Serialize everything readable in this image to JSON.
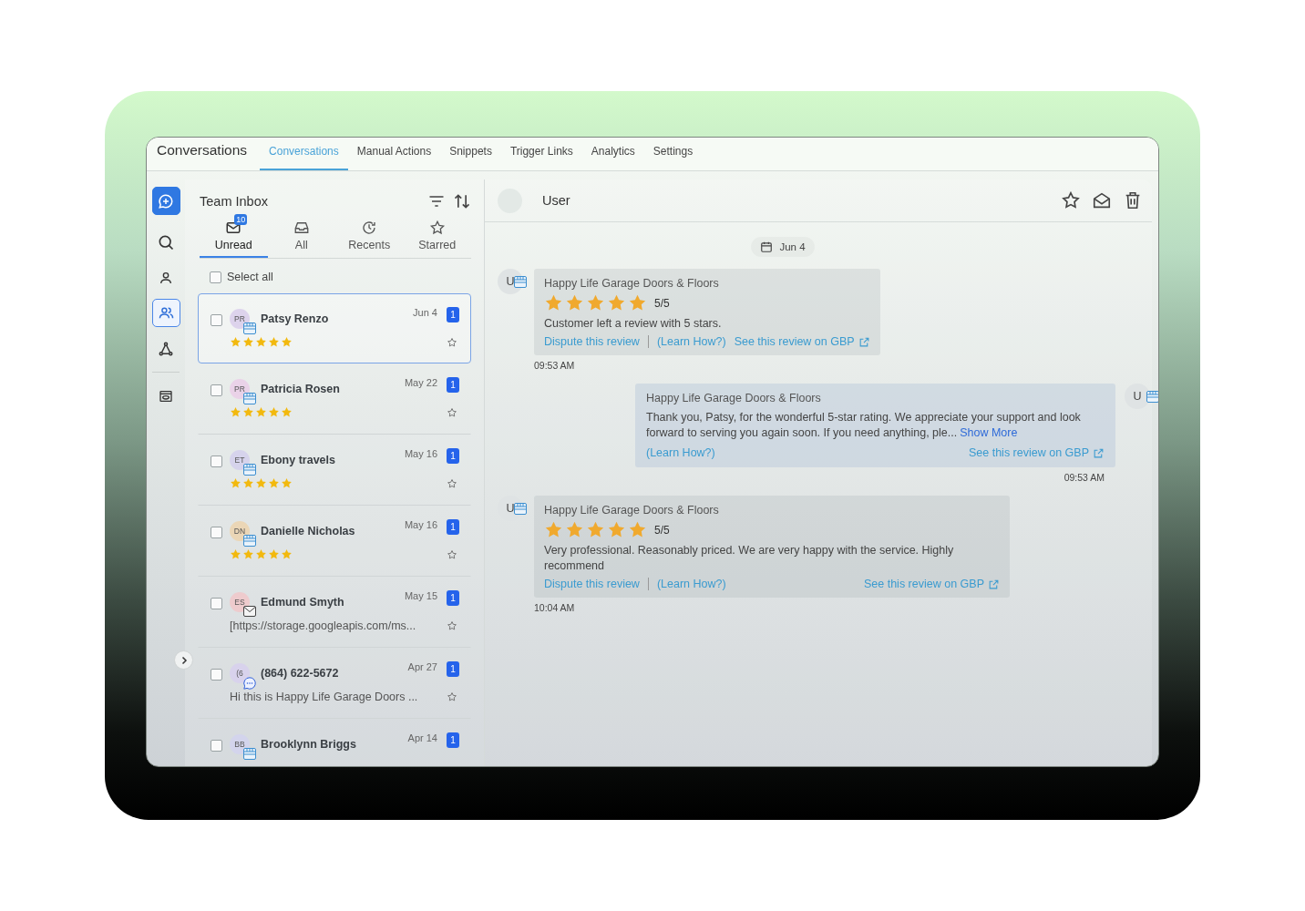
{
  "app_title": "Conversations",
  "nav_tabs": [
    {
      "label": "Conversations",
      "selected": true
    },
    {
      "label": "Manual Actions",
      "selected": false
    },
    {
      "label": "Snippets",
      "selected": false
    },
    {
      "label": "Trigger Links",
      "selected": false
    },
    {
      "label": "Analytics",
      "selected": false
    },
    {
      "label": "Settings",
      "selected": false
    }
  ],
  "rail": [
    {
      "kind": "compose",
      "selected": false
    },
    {
      "kind": "search",
      "selected": false
    },
    {
      "kind": "contact",
      "selected": false
    },
    {
      "kind": "team",
      "selected": true
    },
    {
      "kind": "workflow",
      "selected": false
    },
    {
      "kind": "preview",
      "selected": false
    }
  ],
  "inbox": {
    "title": "Team Inbox",
    "filters": [
      {
        "kind": "unread",
        "label": "Unread",
        "badge": "10",
        "selected": true
      },
      {
        "kind": "all",
        "label": "All",
        "selected": false
      },
      {
        "kind": "recents",
        "label": "Recents",
        "selected": false
      },
      {
        "kind": "starred",
        "label": "Starred",
        "selected": false
      }
    ],
    "select_all": {
      "label": "Select all",
      "checked": false
    },
    "conversations": [
      {
        "initials": "PR",
        "color": "#ddd3ec",
        "kind": "review",
        "name": "Patsy Renzo",
        "date": "Jun 4",
        "unread": "1",
        "stars": 5,
        "selected": true,
        "checked": false
      },
      {
        "initials": "PR",
        "color": "#ead2e8",
        "kind": "review",
        "name": "Patricia Rosen",
        "date": "May 22",
        "unread": "1",
        "stars": 5,
        "selected": false,
        "checked": false
      },
      {
        "initials": "ET",
        "color": "#d6d3ec",
        "kind": "review",
        "name": "Ebony travels",
        "date": "May 16",
        "unread": "1",
        "stars": 5,
        "selected": false,
        "checked": false
      },
      {
        "initials": "DN",
        "color": "#ebd6b6",
        "kind": "review",
        "name": "Danielle Nicholas",
        "date": "May 16",
        "unread": "1",
        "stars": 5,
        "selected": false,
        "checked": false
      },
      {
        "initials": "ES",
        "color": "#eecbcd",
        "kind": "email",
        "name": "Edmund Smyth",
        "date": "May 15",
        "unread": "1",
        "preview": "[https://storage.googleapis.com/ms...",
        "selected": false,
        "checked": false
      },
      {
        "initials": "(6",
        "color": "#d8d2ec",
        "kind": "sms",
        "name": "(864) 622-5672",
        "date": "Apr 27",
        "unread": "1",
        "preview": "Hi this is Happy Life Garage Doors ...",
        "selected": false,
        "checked": false
      },
      {
        "initials": "BB",
        "color": "#d3d4ec",
        "kind": "review",
        "name": "Brooklynn Briggs",
        "date": "Apr 14",
        "unread": "1",
        "selected": false,
        "checked": false
      }
    ]
  },
  "chat": {
    "contact": "User",
    "date": "Jun 4",
    "messages": [
      {
        "kind": "review",
        "avatar": "U",
        "business": "Happy Life Garage Doors & Floors",
        "stars": 5,
        "score": "5/5",
        "text": "Customer left a review with 5 stars.",
        "dispute": "Dispute this review",
        "learn": "(Learn How?)",
        "gbp": "See this review on GBP",
        "time": "09:53 AM"
      },
      {
        "kind": "reply",
        "avatar": "U",
        "business": "Happy Life Garage Doors & Floors",
        "text": "Thank you, Patsy, for the wonderful 5-star rating. We appreciate your support and look forward to serving you again soon. If you need anything, ple...",
        "more": "Show More",
        "learn": "(Learn How?)",
        "gbp": "See this review on GBP",
        "time": "09:53 AM"
      },
      {
        "kind": "review",
        "avatar": "U",
        "business": "Happy Life Garage Doors & Floors",
        "stars": 5,
        "score": "5/5",
        "text": "Very professional. Reasonably priced. We are very happy with the service. Highly recommend",
        "dispute": "Dispute this review",
        "learn": "(Learn How?)",
        "gbp": "See this review on GBP",
        "time": "10:04 AM"
      }
    ]
  }
}
